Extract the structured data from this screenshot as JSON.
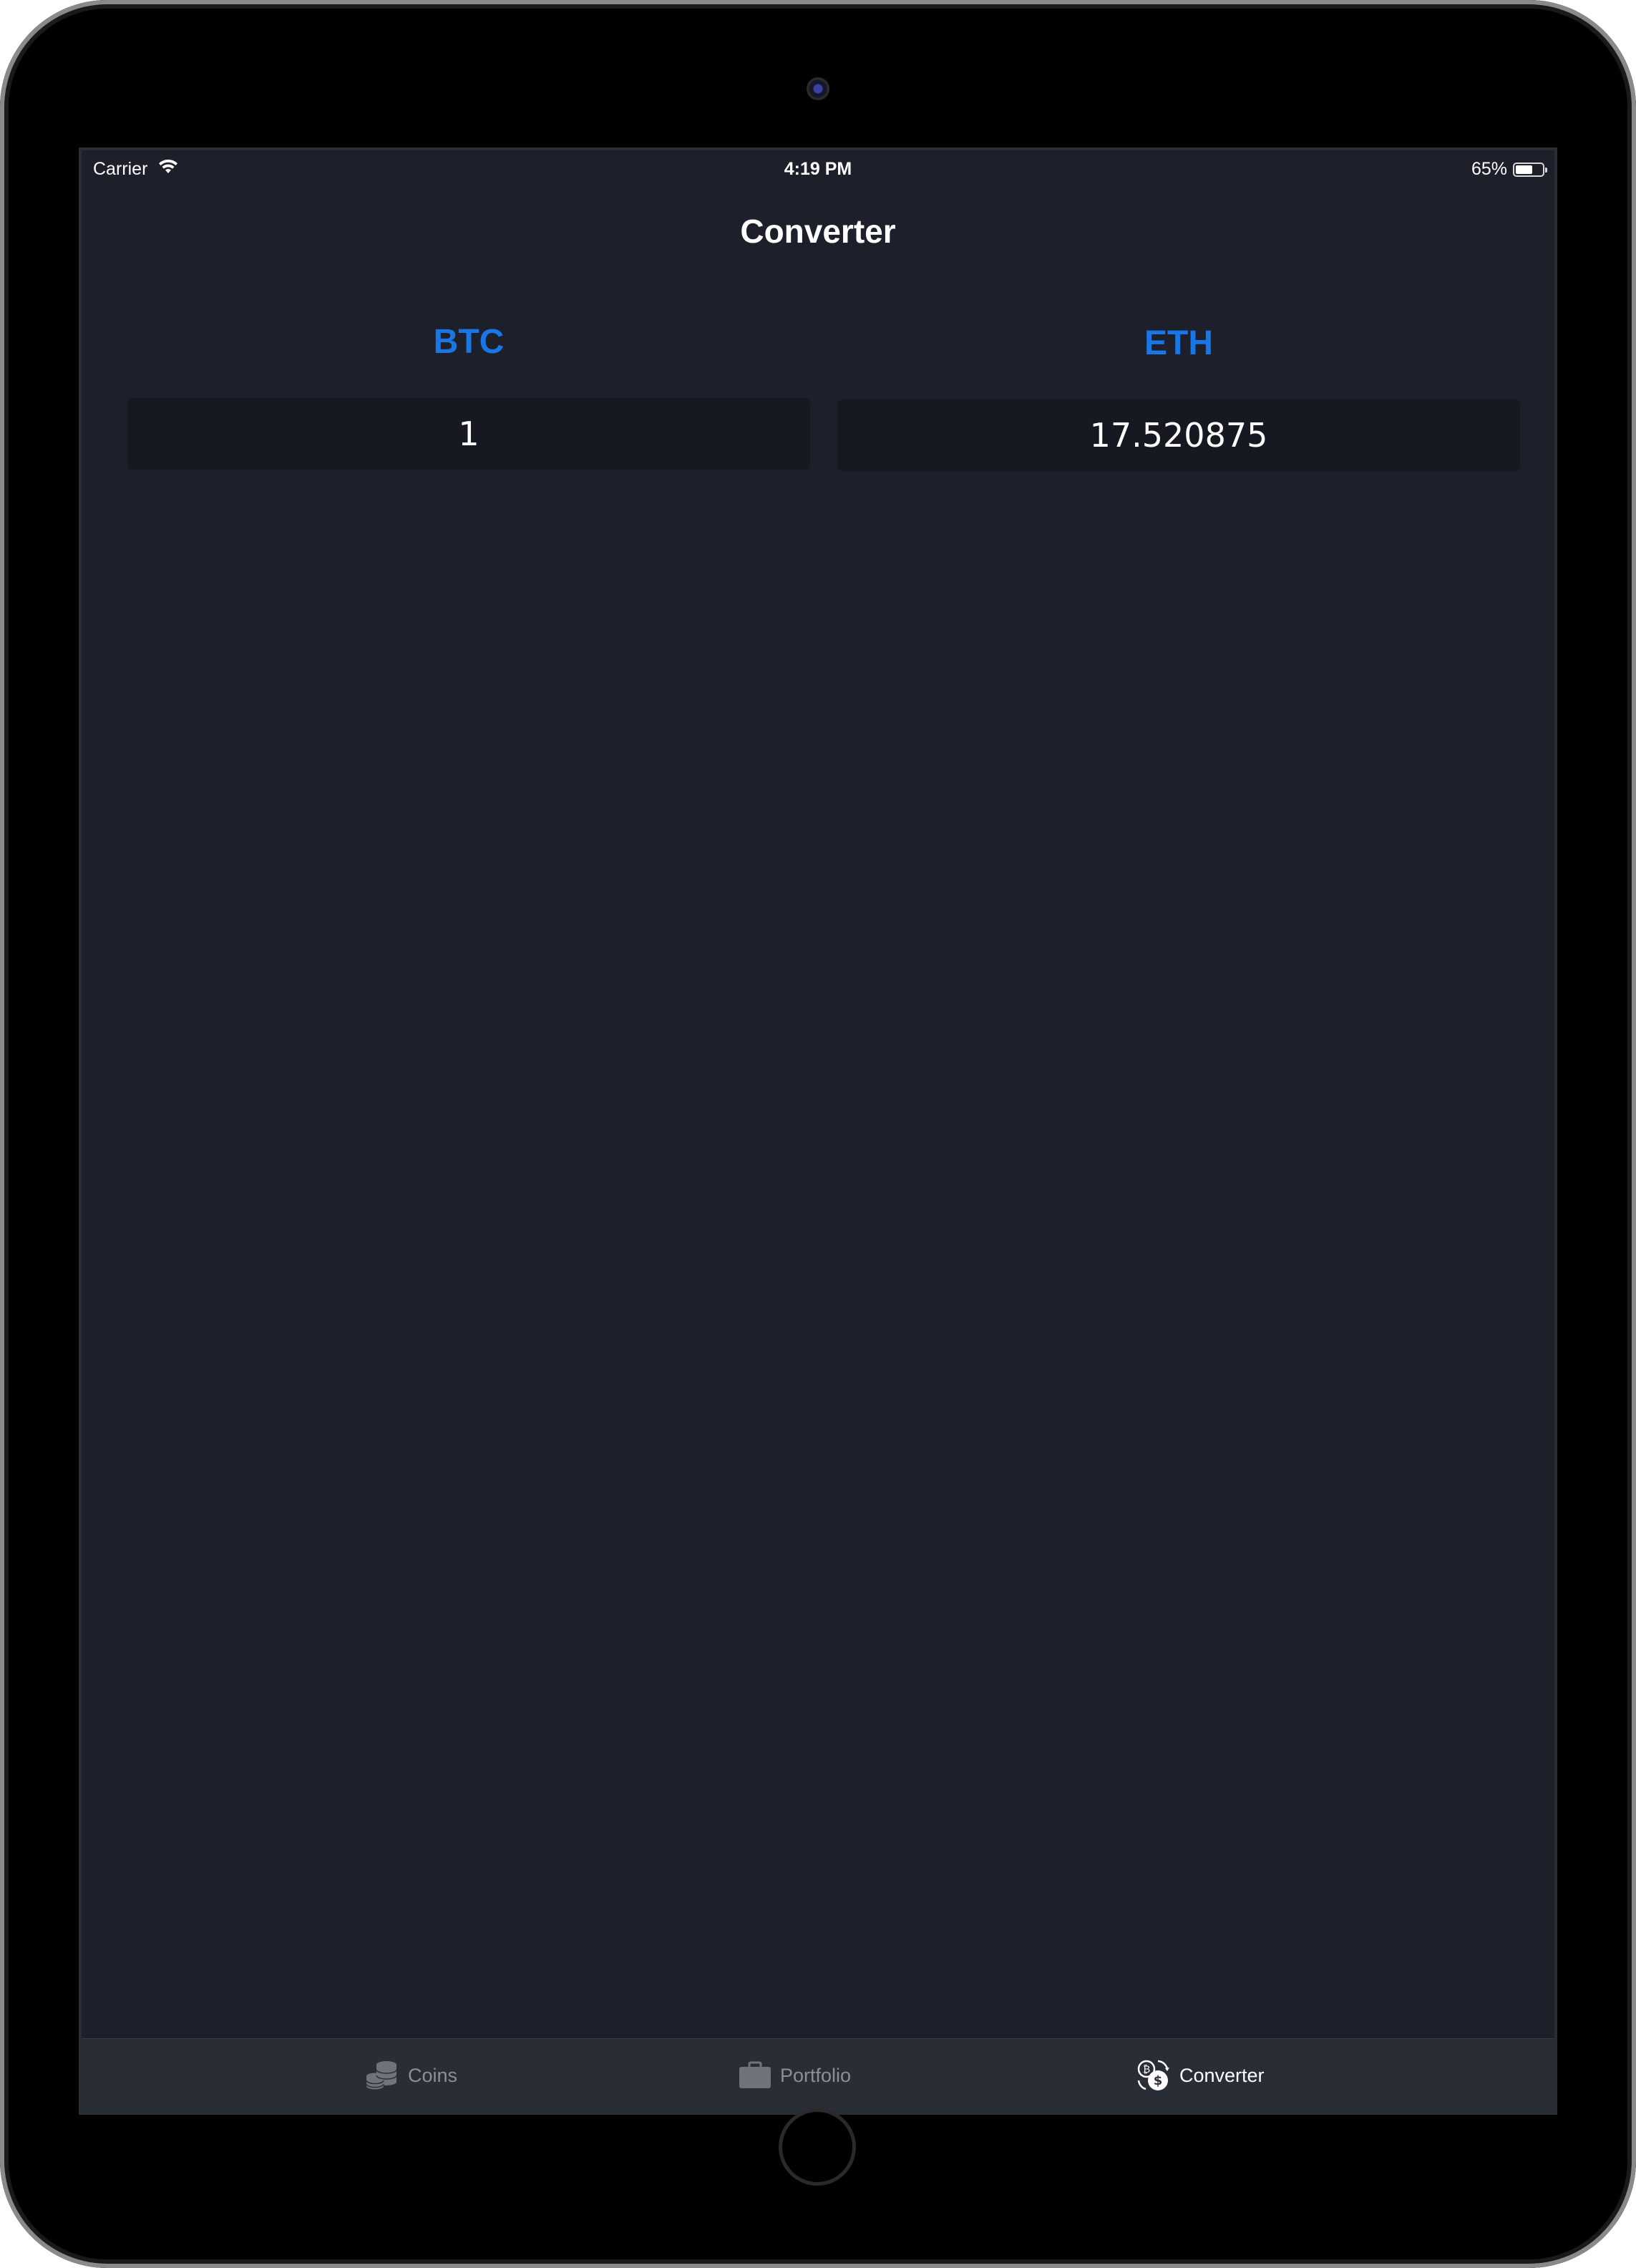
{
  "status_bar": {
    "carrier": "Carrier",
    "time": "4:19 PM",
    "battery_percent": "65%",
    "battery_level": 0.65
  },
  "nav": {
    "title": "Converter"
  },
  "converter": {
    "from_currency": "BTC",
    "to_currency": "ETH",
    "from_amount": "1",
    "to_amount": "17.520875",
    "accent_color": "#1876e6"
  },
  "tab_bar": {
    "items": [
      {
        "label": "Coins",
        "icon": "coins-icon",
        "active": false
      },
      {
        "label": "Portfolio",
        "icon": "briefcase-icon",
        "active": false
      },
      {
        "label": "Converter",
        "icon": "currency-exchange-icon",
        "active": true
      }
    ]
  },
  "colors": {
    "background": "#1d202a",
    "field_background": "#161921",
    "tab_bar_background": "#292d36",
    "tab_inactive": "#8c8f96",
    "tab_active": "#ffffff"
  }
}
